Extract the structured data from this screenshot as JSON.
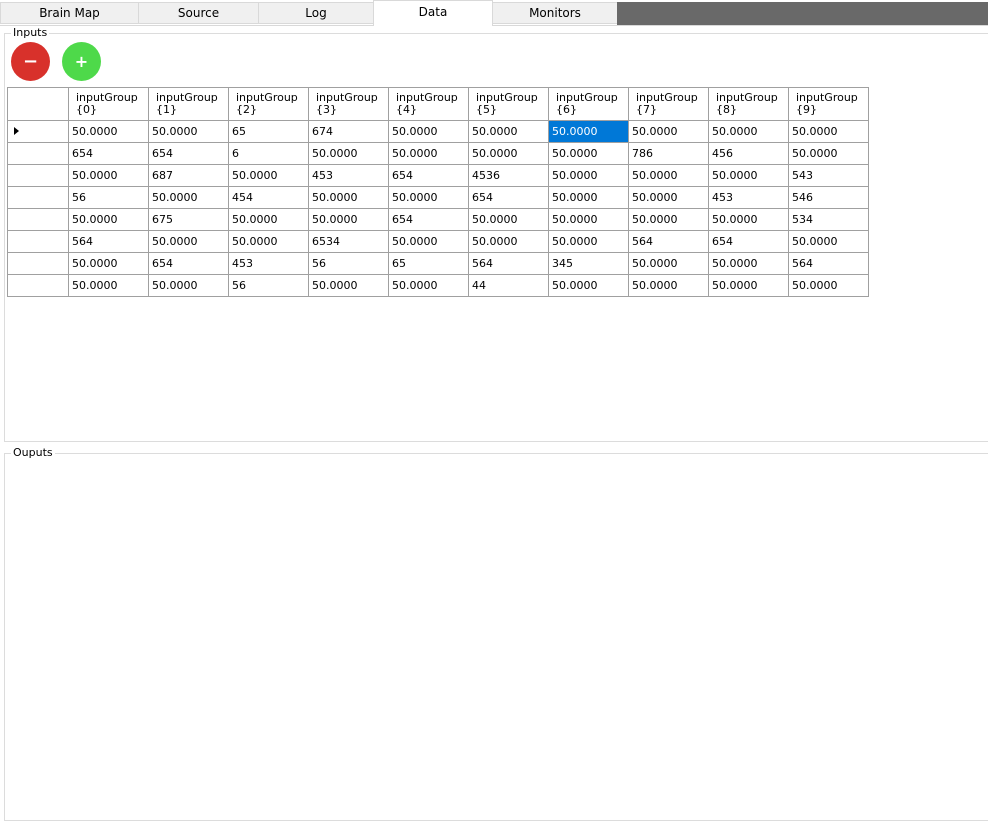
{
  "tabs": [
    {
      "label": "Brain Map",
      "active": false
    },
    {
      "label": "Source",
      "active": false
    },
    {
      "label": "Log",
      "active": false
    },
    {
      "label": "Data",
      "active": true
    },
    {
      "label": "Monitors",
      "active": false
    }
  ],
  "inputs": {
    "legend": "Inputs",
    "remove_button_label": "−",
    "add_button_label": "+",
    "columns": [
      {
        "name": "inputGroup",
        "index": "{0}"
      },
      {
        "name": "inputGroup",
        "index": "{1}"
      },
      {
        "name": "inputGroup",
        "index": "{2}"
      },
      {
        "name": "inputGroup",
        "index": "{3}"
      },
      {
        "name": "inputGroup",
        "index": "{4}"
      },
      {
        "name": "inputGroup",
        "index": "{5}"
      },
      {
        "name": "inputGroup",
        "index": "{6}"
      },
      {
        "name": "inputGroup",
        "index": "{7}"
      },
      {
        "name": "inputGroup",
        "index": "{8}"
      },
      {
        "name": "inputGroup",
        "index": "{9}"
      }
    ],
    "rows": [
      [
        "50.0000",
        "50.0000",
        "65",
        "674",
        "50.0000",
        "50.0000",
        "50.0000",
        "50.0000",
        "50.0000",
        "50.0000"
      ],
      [
        "654",
        "654",
        "6",
        "50.0000",
        "50.0000",
        "50.0000",
        "50.0000",
        "786",
        "456",
        "50.0000"
      ],
      [
        "50.0000",
        "687",
        "50.0000",
        "453",
        "654",
        "4536",
        "50.0000",
        "50.0000",
        "50.0000",
        "543"
      ],
      [
        "56",
        "50.0000",
        "454",
        "50.0000",
        "50.0000",
        "654",
        "50.0000",
        "50.0000",
        "453",
        "546"
      ],
      [
        "50.0000",
        "675",
        "50.0000",
        "50.0000",
        "654",
        "50.0000",
        "50.0000",
        "50.0000",
        "50.0000",
        "534"
      ],
      [
        "564",
        "50.0000",
        "50.0000",
        "6534",
        "50.0000",
        "50.0000",
        "50.0000",
        "564",
        "654",
        "50.0000"
      ],
      [
        "50.0000",
        "654",
        "453",
        "56",
        "65",
        "564",
        "345",
        "50.0000",
        "50.0000",
        "564"
      ],
      [
        "50.0000",
        "50.0000",
        "56",
        "50.0000",
        "50.0000",
        "44",
        "50.0000",
        "50.0000",
        "50.0000",
        "50.0000"
      ]
    ],
    "current_row": 0,
    "selected_cell": {
      "row": 0,
      "col": 6
    }
  },
  "outputs": {
    "legend": "Ouputs"
  },
  "colors": {
    "selection": "#0078d7",
    "remove_button": "#d8312b",
    "add_button": "#4ed94a",
    "tab_strip_filler": "#696969"
  }
}
